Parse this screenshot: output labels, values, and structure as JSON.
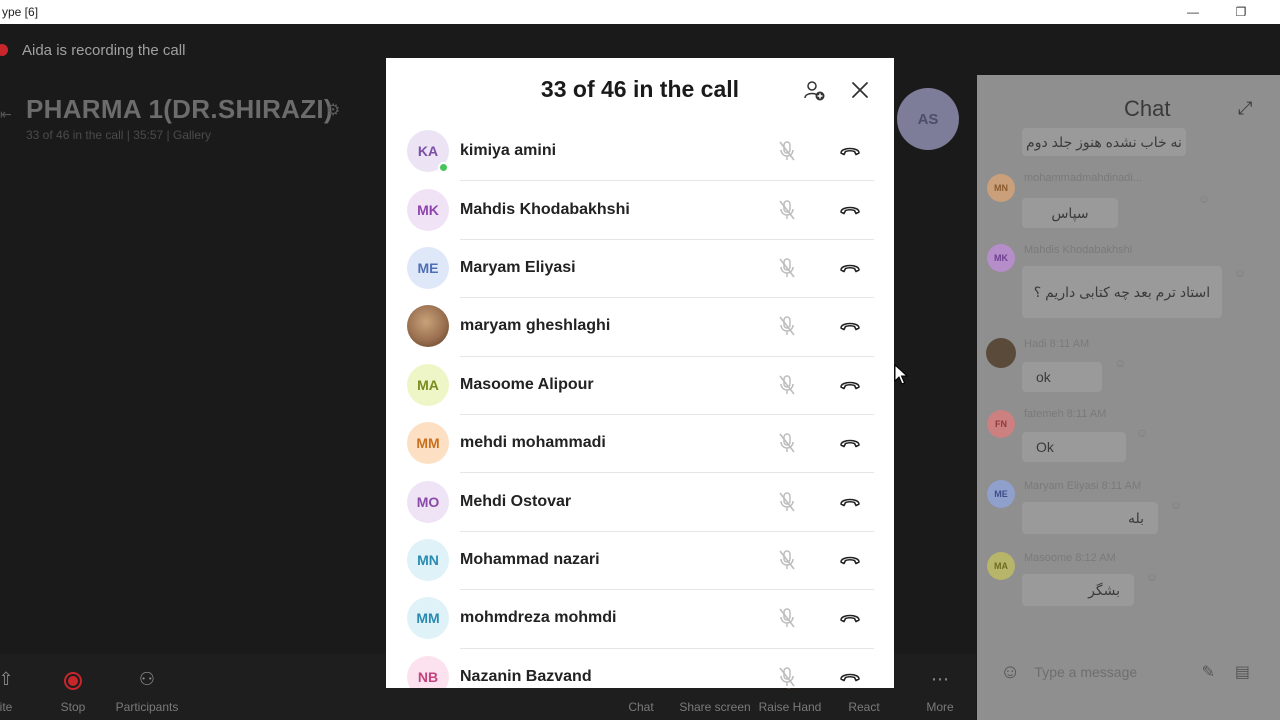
{
  "window": {
    "title": "ype [6]",
    "minimize_glyph": "—",
    "restore_glyph": "❐"
  },
  "call": {
    "recording_text": "Aida is recording the call",
    "title": "PHARMA 1(DR.SHIRAZI)",
    "subtitle": "33 of 46 in the call | 35:57 |  Gallery",
    "presenter_initials": "AS"
  },
  "toolbar": {
    "items": [
      {
        "label": "ite",
        "icon": "share-icon"
      },
      {
        "label": "Stop",
        "icon": "stop-recording-icon"
      },
      {
        "label": "Participants",
        "icon": "participants-icon"
      },
      {
        "label": "Chat",
        "icon": "chat-icon"
      },
      {
        "label": "Share screen",
        "icon": "share-screen-icon"
      },
      {
        "label": "Raise Hand",
        "icon": "raise-hand-icon"
      },
      {
        "label": "React",
        "icon": "react-icon"
      },
      {
        "label": "More",
        "icon": "more-icon"
      }
    ]
  },
  "chat": {
    "title": "Chat",
    "input_placeholder": "Type a message",
    "messages": [
      {
        "initials": "",
        "sender": "",
        "text": "نه خاب نشده هنوز جلد دوم",
        "av_color": ""
      },
      {
        "initials": "MN",
        "sender": "mohammadmahdinadi...",
        "text": "سپاس",
        "av_color": "#c9a07a"
      },
      {
        "initials": "MK",
        "sender": "Mahdis Khodabakhshi",
        "text": "استاد ترم بعد چه کتابی داریم ؟",
        "av_color": "#b58dc9"
      },
      {
        "initials": "",
        "sender": "Hadi 8:11 AM",
        "text": "ok",
        "av_color": "#5a4a3a"
      },
      {
        "initials": "FN",
        "sender": "fatemeh 8:11 AM",
        "text": "Ok",
        "av_color": "#cc8080"
      },
      {
        "initials": "ME",
        "sender": "Maryam Eliyasi 8:11 AM",
        "text": "بله",
        "av_color": "#8fa0cc"
      },
      {
        "initials": "MA",
        "sender": "Masoome 8:12 AM",
        "text": "بشگر",
        "av_color": "#b7b56a"
      }
    ]
  },
  "modal": {
    "title": "33 of 46 in the call",
    "participants": [
      {
        "initials": "KA",
        "name": "kimiya amini",
        "bg": "#ece4f5",
        "fg": "#7b4fa8",
        "online": true,
        "photo": false
      },
      {
        "initials": "MK",
        "name": "Mahdis Khodabakhshi",
        "bg": "#f1e3f6",
        "fg": "#8e44ad",
        "online": false,
        "photo": false
      },
      {
        "initials": "ME",
        "name": "Maryam Eliyasi",
        "bg": "#dfe8f8",
        "fg": "#4f6fb5",
        "online": false,
        "photo": false
      },
      {
        "initials": "",
        "name": "maryam gheshlaghi",
        "bg": "#9a7050",
        "fg": "#ffffff",
        "online": false,
        "photo": true
      },
      {
        "initials": "MA",
        "name": "Masoome Alipour",
        "bg": "#eef6c7",
        "fg": "#7a8a1e",
        "online": false,
        "photo": false
      },
      {
        "initials": "MM",
        "name": "mehdi mohammadi",
        "bg": "#fde0c4",
        "fg": "#c9701f",
        "online": false,
        "photo": false
      },
      {
        "initials": "MO",
        "name": "Mehdi Ostovar",
        "bg": "#efe3f6",
        "fg": "#8a4aa8",
        "online": false,
        "photo": false
      },
      {
        "initials": "MN",
        "name": "Mohammad nazari",
        "bg": "#dff2f8",
        "fg": "#2a8bb0",
        "online": false,
        "photo": false
      },
      {
        "initials": "MM",
        "name": "mohmdreza mohmdi",
        "bg": "#dff2f8",
        "fg": "#2a8bb0",
        "online": false,
        "photo": false
      },
      {
        "initials": "NB",
        "name": "Nazanin Bazvand",
        "bg": "#fbe2ee",
        "fg": "#c2437e",
        "online": false,
        "photo": false
      }
    ]
  },
  "colors": {
    "recording": "#c8262b",
    "presence": "#47c55a",
    "modal_bg": "#ffffff"
  }
}
